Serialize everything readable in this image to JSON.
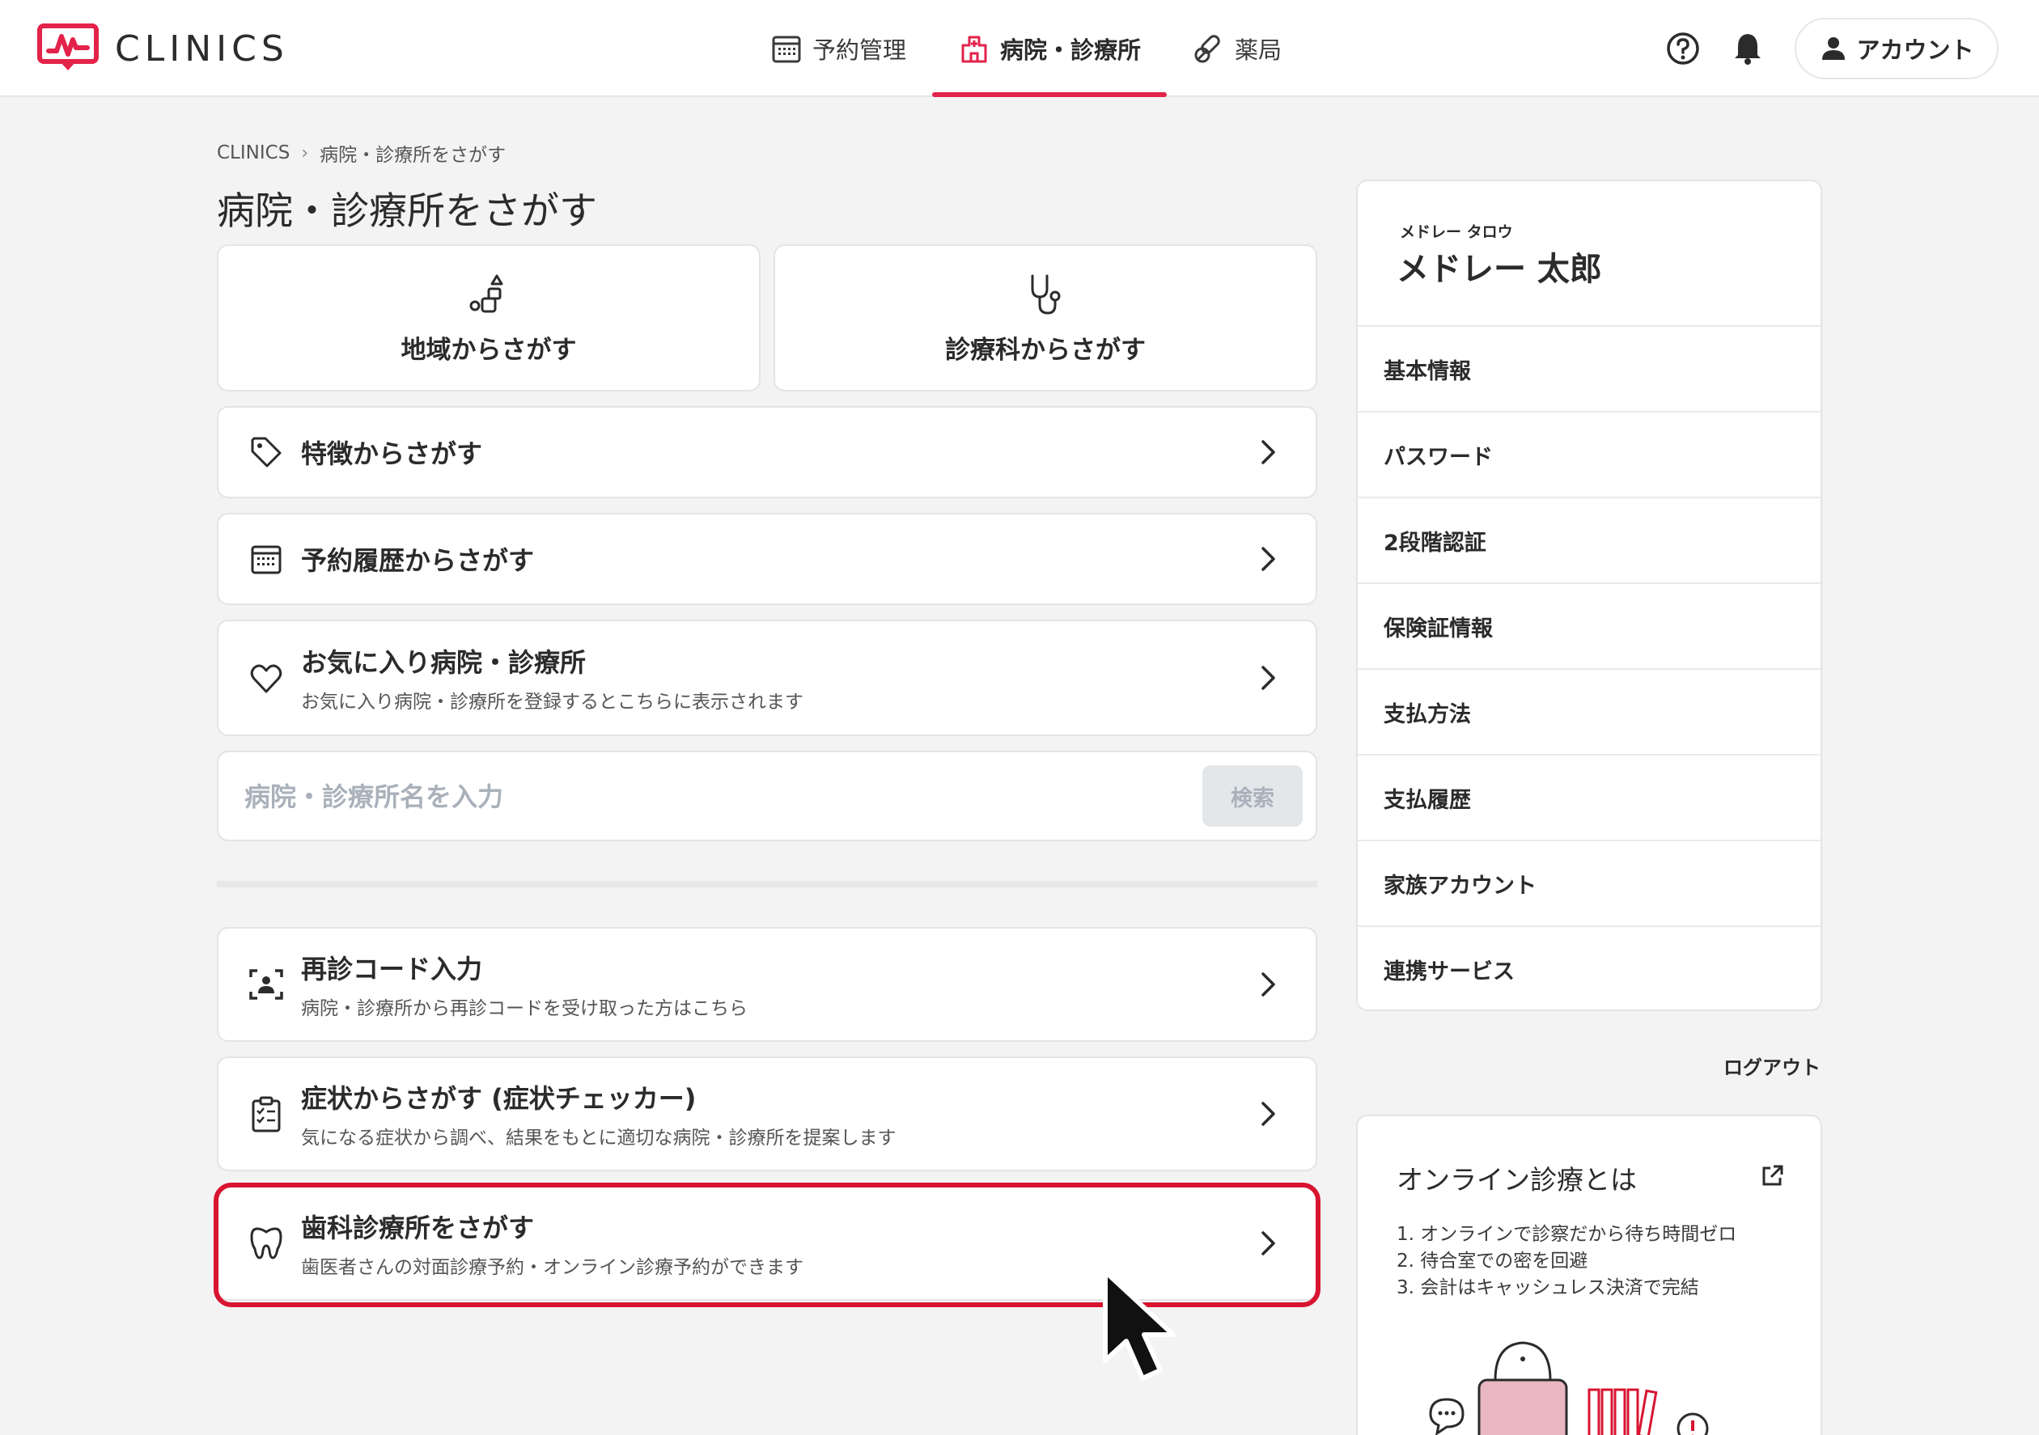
{
  "header": {
    "logo_text": "CLINICS",
    "nav": [
      {
        "label": "予約管理",
        "icon": "calendar-icon",
        "active": false
      },
      {
        "label": "病院・診療所",
        "icon": "hospital-icon",
        "active": true
      },
      {
        "label": "薬局",
        "icon": "pill-icon",
        "active": false
      }
    ],
    "help_icon": "question-circle-icon",
    "bell_icon": "bell-icon",
    "account_label": "アカウント",
    "accent_color": "#e3234a"
  },
  "breadcrumb": [
    "CLINICS",
    "病院・診療所をさがす"
  ],
  "page_title": "病院・診療所をさがす",
  "search_tiles": [
    {
      "label": "地域からさがす",
      "icon": "region-icon"
    },
    {
      "label": "診療科からさがす",
      "icon": "stethoscope-icon"
    }
  ],
  "options": [
    {
      "title": "特徴からさがす",
      "icon": "tag-icon"
    },
    {
      "title": "予約履歴からさがす",
      "icon": "calendar-icon"
    },
    {
      "title": "お気に入り病院・診療所",
      "sub": "お気に入り病院・診療所を登録するとこちらに表示されます",
      "icon": "heart-icon"
    }
  ],
  "search": {
    "placeholder": "病院・診療所名を入力",
    "button": "検索"
  },
  "extra_options": [
    {
      "title": "再診コード入力",
      "sub": "病院・診療所から再診コードを受け取った方はこちら",
      "icon": "scan-code-icon"
    },
    {
      "title": "症状からさがす (症状チェッカー)",
      "sub": "気になる症状から調べ、結果をもとに適切な病院・診療所を提案します",
      "icon": "clipboard-check-icon"
    },
    {
      "title": "歯科診療所をさがす",
      "sub": "歯医者さんの対面診療予約・オンライン診療予約ができます",
      "icon": "tooth-icon",
      "highlighted": true
    }
  ],
  "highlight_color": "#d81430",
  "profile": {
    "kana": "メドレー タロウ",
    "name": "メドレー 太郎",
    "menu": [
      "基本情報",
      "パスワード",
      "2段階認証",
      "保険証情報",
      "支払方法",
      "支払履歴",
      "家族アカウント",
      "連携サービス"
    ]
  },
  "logout": "ログアウト",
  "info": {
    "title": "オンライン診療とは",
    "items": [
      "1. オンラインで診察だから待ち時間ゼロ",
      "2. 待合室での密を回避",
      "3. 会計はキャッシュレス決済で完結"
    ]
  }
}
